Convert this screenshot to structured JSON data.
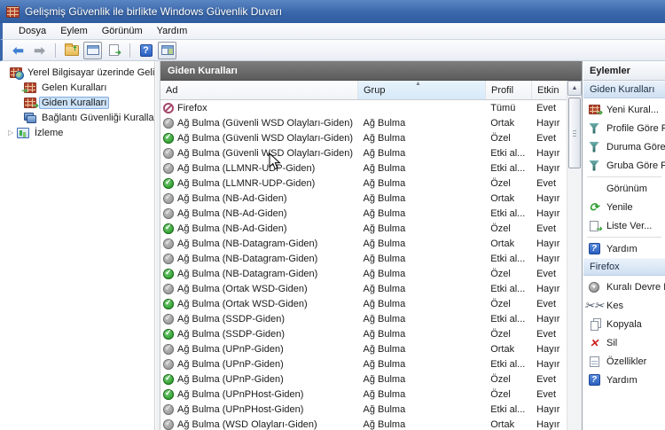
{
  "window": {
    "title": "Gelişmiş Güvenlik ile birlikte Windows Güvenlik Duvarı"
  },
  "menubar": {
    "items": [
      "Dosya",
      "Eylem",
      "Görünüm",
      "Yardım"
    ]
  },
  "toolbar": {
    "icons": [
      "back-icon",
      "forward-icon",
      "up-folder-icon",
      "console-tree-toggle-icon",
      "export-list-icon",
      "help-icon",
      "action-pane-toggle-icon"
    ]
  },
  "tree": {
    "root": {
      "label": "Yerel Bilgisayar üzerinde Gelişm",
      "icon": "firewall-globe-icon"
    },
    "items": [
      {
        "label": "Gelen Kuralları",
        "icon": "inbound-rules-icon",
        "selected": false
      },
      {
        "label": "Giden Kuralları",
        "icon": "outbound-rules-icon",
        "selected": true
      },
      {
        "label": "Bağlantı Güvenliği Kuralları",
        "icon": "connection-security-icon",
        "selected": false
      },
      {
        "label": "İzleme",
        "icon": "monitoring-icon",
        "selected": false,
        "expander": "▷"
      }
    ]
  },
  "main": {
    "header": "Giden Kuralları",
    "columns": [
      "Ad",
      "Grup",
      "Profil",
      "Etkin"
    ],
    "sort_column": "Grup",
    "rows": [
      {
        "name": "Firefox",
        "group": "",
        "profile": "Tümü",
        "enabled": "Evet",
        "state": "blocked"
      },
      {
        "name": "Ağ Bulma (Güvenli WSD Olayları-Giden)",
        "group": "Ağ Bulma",
        "profile": "Ortak",
        "enabled": "Hayır",
        "state": "disabled"
      },
      {
        "name": "Ağ Bulma (Güvenli WSD Olayları-Giden)",
        "group": "Ağ Bulma",
        "profile": "Özel",
        "enabled": "Evet",
        "state": "enabled"
      },
      {
        "name": "Ağ Bulma (Güvenli WSD Olayları-Giden)",
        "group": "Ağ Bulma",
        "profile": "Etki al...",
        "enabled": "Hayır",
        "state": "disabled"
      },
      {
        "name": "Ağ Bulma (LLMNR-UDP-Giden)",
        "group": "Ağ Bulma",
        "profile": "Etki al...",
        "enabled": "Hayır",
        "state": "disabled"
      },
      {
        "name": "Ağ Bulma (LLMNR-UDP-Giden)",
        "group": "Ağ Bulma",
        "profile": "Özel",
        "enabled": "Evet",
        "state": "enabled"
      },
      {
        "name": "Ağ Bulma (NB-Ad-Giden)",
        "group": "Ağ Bulma",
        "profile": "Ortak",
        "enabled": "Hayır",
        "state": "disabled"
      },
      {
        "name": "Ağ Bulma (NB-Ad-Giden)",
        "group": "Ağ Bulma",
        "profile": "Etki al...",
        "enabled": "Hayır",
        "state": "disabled"
      },
      {
        "name": "Ağ Bulma (NB-Ad-Giden)",
        "group": "Ağ Bulma",
        "profile": "Özel",
        "enabled": "Evet",
        "state": "enabled"
      },
      {
        "name": "Ağ Bulma (NB-Datagram-Giden)",
        "group": "Ağ Bulma",
        "profile": "Ortak",
        "enabled": "Hayır",
        "state": "disabled"
      },
      {
        "name": "Ağ Bulma (NB-Datagram-Giden)",
        "group": "Ağ Bulma",
        "profile": "Etki al...",
        "enabled": "Hayır",
        "state": "disabled"
      },
      {
        "name": "Ağ Bulma (NB-Datagram-Giden)",
        "group": "Ağ Bulma",
        "profile": "Özel",
        "enabled": "Evet",
        "state": "enabled"
      },
      {
        "name": "Ağ Bulma (Ortak WSD-Giden)",
        "group": "Ağ Bulma",
        "profile": "Etki al...",
        "enabled": "Hayır",
        "state": "disabled"
      },
      {
        "name": "Ağ Bulma (Ortak WSD-Giden)",
        "group": "Ağ Bulma",
        "profile": "Özel",
        "enabled": "Evet",
        "state": "enabled"
      },
      {
        "name": "Ağ Bulma (SSDP-Giden)",
        "group": "Ağ Bulma",
        "profile": "Etki al...",
        "enabled": "Hayır",
        "state": "disabled"
      },
      {
        "name": "Ağ Bulma (SSDP-Giden)",
        "group": "Ağ Bulma",
        "profile": "Özel",
        "enabled": "Evet",
        "state": "enabled"
      },
      {
        "name": "Ağ Bulma (UPnP-Giden)",
        "group": "Ağ Bulma",
        "profile": "Ortak",
        "enabled": "Hayır",
        "state": "disabled"
      },
      {
        "name": "Ağ Bulma (UPnP-Giden)",
        "group": "Ağ Bulma",
        "profile": "Etki al...",
        "enabled": "Hayır",
        "state": "disabled"
      },
      {
        "name": "Ağ Bulma (UPnP-Giden)",
        "group": "Ağ Bulma",
        "profile": "Özel",
        "enabled": "Evet",
        "state": "enabled"
      },
      {
        "name": "Ağ Bulma (UPnPHost-Giden)",
        "group": "Ağ Bulma",
        "profile": "Özel",
        "enabled": "Evet",
        "state": "enabled"
      },
      {
        "name": "Ağ Bulma (UPnPHost-Giden)",
        "group": "Ağ Bulma",
        "profile": "Etki al...",
        "enabled": "Hayır",
        "state": "disabled"
      },
      {
        "name": "Ağ Bulma (WSD Olayları-Giden)",
        "group": "Ağ Bulma",
        "profile": "Ortak",
        "enabled": "Hayır",
        "state": "disabled"
      }
    ]
  },
  "actions": {
    "header": "Eylemler",
    "sections": [
      {
        "title": "Giden Kuralları",
        "items": [
          {
            "label": "Yeni Kural...",
            "icon": "new-rule-icon"
          },
          {
            "label": "Profile Göre Fil",
            "icon": "filter-icon"
          },
          {
            "label": "Duruma Göre F",
            "icon": "filter-icon"
          },
          {
            "label": "Gruba Göre Filt",
            "icon": "filter-icon"
          },
          {
            "label": "Görünüm",
            "icon": "none",
            "sep_before": true
          },
          {
            "label": "Yenile",
            "icon": "refresh-icon"
          },
          {
            "label": "Liste Ver...",
            "icon": "export-list-icon"
          },
          {
            "label": "Yardım",
            "icon": "help-icon",
            "sep_before": true
          }
        ]
      },
      {
        "title": "Firefox",
        "items": [
          {
            "label": "Kuralı Devre Dı",
            "icon": "disable-rule-icon"
          },
          {
            "label": "Kes",
            "icon": "cut-icon"
          },
          {
            "label": "Kopyala",
            "icon": "copy-icon"
          },
          {
            "label": "Sil",
            "icon": "delete-icon"
          },
          {
            "label": "Özellikler",
            "icon": "properties-icon"
          },
          {
            "label": "Yardım",
            "icon": "help-icon"
          }
        ]
      }
    ]
  },
  "colors": {
    "titlebar": "#3a67ab",
    "selection": "#cbe2f8",
    "enabled_icon": "#2f9e2f",
    "disabled_icon": "#9a9a9a",
    "blocked_icon": "#a4486a",
    "list_title_bar": "#6b6b6b",
    "sorted_column": "#d6e9f9"
  }
}
